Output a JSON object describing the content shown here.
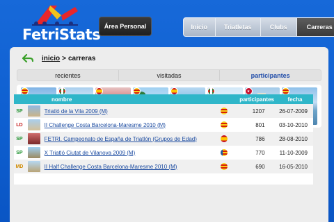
{
  "brand": {
    "name": "FetriStats"
  },
  "header": {
    "area_personal": "Área Personal",
    "nav": [
      {
        "label": "Inicio",
        "active": false
      },
      {
        "label": "Triatletas",
        "active": false
      },
      {
        "label": "Clubs",
        "active": false
      },
      {
        "label": "Carreras",
        "active": true
      }
    ]
  },
  "breadcrumb": {
    "home": "inicio",
    "sep": ">",
    "current": "carreras"
  },
  "subtabs": [
    {
      "label": "recientes",
      "active": false
    },
    {
      "label": "visitadas",
      "active": false
    },
    {
      "label": "participantes",
      "active": true
    }
  ],
  "thumbnails": [
    {
      "flag": "cat",
      "scene": "beach-towers"
    },
    {
      "flag": "bas",
      "scene": "beach"
    },
    {
      "flag": "esp",
      "scene": "race-crowd"
    },
    {
      "flag": "cat",
      "scene": "palm-promenade"
    },
    {
      "flag": "esp",
      "scene": "coast"
    },
    {
      "flag": "bas",
      "scene": "bay"
    },
    {
      "flag": "mad",
      "scene": "city-monument"
    },
    {
      "flag": "cat",
      "scene": "lake-city"
    }
  ],
  "table": {
    "headers": {
      "nombre": "nombre",
      "participantes": "participantes",
      "fecha": "fecha"
    },
    "rows": [
      {
        "code": "SP",
        "name": "Triatló de la Vila 2009 (M)",
        "flag": "cat",
        "participantes": "1207",
        "fecha": "26-07-2009",
        "code_color": "#1a8f2a"
      },
      {
        "code": "LD",
        "name": "II Challenge Costa Barcelona-Maresme 2010 (M)",
        "flag": "cat",
        "participantes": "801",
        "fecha": "03-10-2010",
        "code_color": "#c41a1a"
      },
      {
        "code": "SP",
        "name": "FETRI. Campeonato de España de Triatlón (Grupos de Edad)",
        "flag": "esp",
        "participantes": "786",
        "fecha": "28-08-2010",
        "code_color": "#1a8f2a"
      },
      {
        "code": "SP",
        "name": "X Triatló Ciutat de Vilanova 2009 (M)",
        "flag": "val",
        "participantes": "770",
        "fecha": "11-10-2009",
        "code_color": "#1a8f2a"
      },
      {
        "code": "MD",
        "name": "II Half Challenge Costa Barcelona-Maresme 2010 (M)",
        "flag": "cat",
        "participantes": "690",
        "fecha": "16-05-2010",
        "code_color": "#d08a00"
      }
    ]
  }
}
